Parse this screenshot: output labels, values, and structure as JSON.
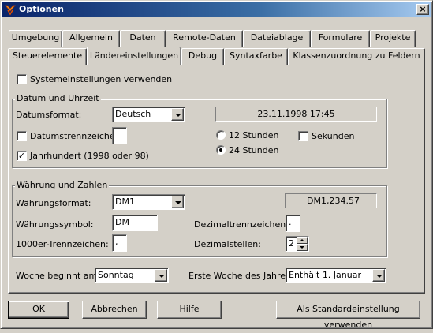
{
  "window": {
    "title": "Optionen",
    "close_glyph": "×"
  },
  "tabs_row1": [
    "Umgebung",
    "Allgemein",
    "Daten",
    "Remote-Daten",
    "Dateiablage",
    "Formulare",
    "Projekte"
  ],
  "tabs_row2": [
    "Steuerelemente",
    "Ländereinstellungen",
    "Debug",
    "Syntaxfarbe",
    "Klassenzuordnung zu Feldern"
  ],
  "active_tab": "Ländereinstellungen",
  "system_settings": {
    "label": "Systemeinstellungen verwenden",
    "checked": false
  },
  "datetime": {
    "group_label": "Datum und Uhrzeit",
    "format_label": "Datumsformat:",
    "format_value": "Deutsch",
    "separator_label": "Datumstrennzeichen:",
    "separator_checked": false,
    "separator_value": "",
    "century_label": "Jahrhundert (1998 oder 98)",
    "century_checked": true,
    "preview": "23.11.1998 17:45",
    "hours12_label": "12 Stunden",
    "hours24_label": "24 Stunden",
    "selected_hours": "24",
    "seconds_label": "Sekunden",
    "seconds_checked": false
  },
  "currency": {
    "group_label": "Währung und Zahlen",
    "format_label": "Währungsformat:",
    "format_value": "DM1",
    "preview": "DM1,234.57",
    "symbol_label": "Währungssymbol:",
    "symbol_value": "DM",
    "decimal_sep_label": "Dezimaltrennzeichen:",
    "decimal_sep_value": ".",
    "thousand_sep_label": "1000er-Trennzeichen:",
    "thousand_sep_value": ",",
    "decimals_label": "Dezimalstellen:",
    "decimals_value": "2"
  },
  "week": {
    "start_label": "Woche beginnt am:",
    "start_value": "Sonntag",
    "first_week_label": "Erste Woche des Jahres:",
    "first_week_value": "Enthält 1. Januar"
  },
  "buttons": {
    "ok": "OK",
    "cancel": "Abbrechen",
    "help": "Hilfe",
    "default": "Als Standardeinstellung verwenden"
  }
}
